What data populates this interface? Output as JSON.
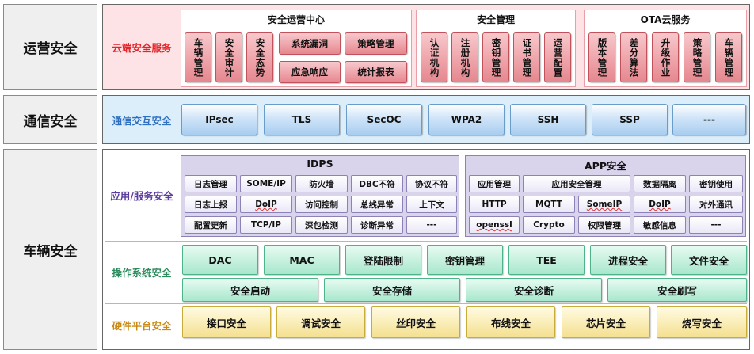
{
  "rows": {
    "ops": "运营安全",
    "comm": "通信安全",
    "vehicle": "车辆安全"
  },
  "cloud": {
    "category": "云端安全服务",
    "colors": {
      "category": "#e2252b",
      "panel_bg": "#fde3e5"
    },
    "groups": [
      {
        "title": "安全运营中心",
        "items": [
          "车辆管理",
          "安全审计",
          "安全态势",
          "系统漏洞",
          "策略管理",
          "应急响应",
          "统计报表"
        ]
      },
      {
        "title": "安全管理",
        "items": [
          "认证机构",
          "注册机构",
          "密钥管理",
          "证书管理",
          "运营配置"
        ]
      },
      {
        "title": "OTA云服务",
        "items": [
          "版本管理",
          "差分算法",
          "升级作业",
          "策略管理",
          "车辆管理"
        ]
      }
    ]
  },
  "comm": {
    "category": "通信交互安全",
    "colors": {
      "category": "#2f6fbf",
      "panel_bg": "#ddeefb"
    },
    "items": [
      "IPsec",
      "TLS",
      "SecOC",
      "WPA2",
      "SSH",
      "SSP",
      "---"
    ]
  },
  "app": {
    "category": "应用/服务安全",
    "colors": {
      "category": "#5b3c9e"
    },
    "idps": {
      "title": "IDPS",
      "items": [
        "日志管理",
        "SOME/IP",
        "防火墙",
        "DBC不符",
        "协议不符",
        "日志上报",
        "DoIP",
        "访问控制",
        "总线异常",
        "上下文",
        "配置更新",
        "TCP/IP",
        "深包检测",
        "诊断异常",
        "---"
      ]
    },
    "appsec": {
      "title": "APP安全",
      "items": [
        "应用管理",
        "应用安全管理",
        "数据隔离",
        "密钥使用",
        "HTTP",
        "MQTT",
        "SomeIP",
        "DoIP",
        "对外通讯",
        "openssl",
        "Crypto",
        "权限管理",
        "敏感信息",
        "---"
      ]
    }
  },
  "os": {
    "category": "操作系统安全",
    "colors": {
      "category": "#2a8a5c"
    },
    "row1": [
      "DAC",
      "MAC",
      "登陆限制",
      "密钥管理",
      "TEE",
      "进程安全",
      "文件安全"
    ],
    "row2": [
      "安全启动",
      "安全存储",
      "安全诊断",
      "安全刷写"
    ]
  },
  "hw": {
    "category": "硬件平台安全",
    "colors": {
      "category": "#c98a12"
    },
    "items": [
      "接口安全",
      "调试安全",
      "丝印安全",
      "布线安全",
      "芯片安全",
      "烧写安全"
    ]
  }
}
